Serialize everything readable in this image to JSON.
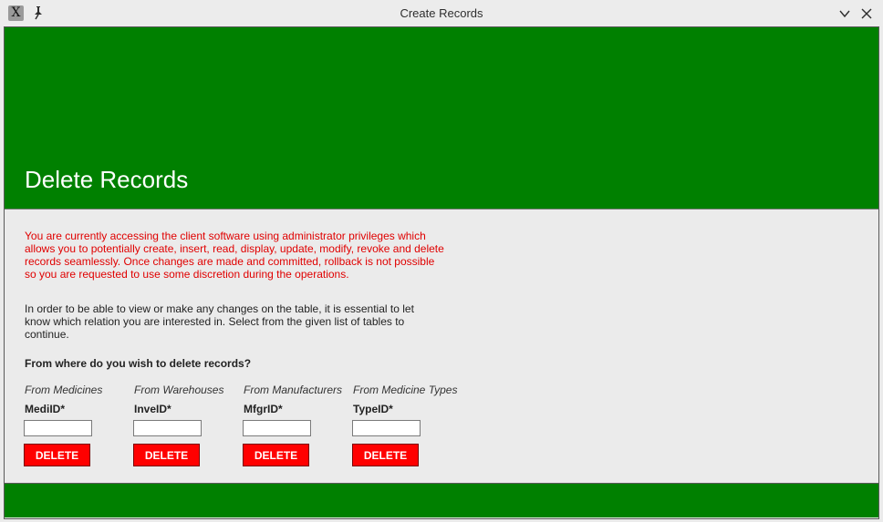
{
  "window": {
    "title": "Create Records",
    "icons": {
      "app": "x-app-icon",
      "pin": "pin-icon",
      "minimize": "chevron-down-icon",
      "close": "close-icon"
    }
  },
  "colors": {
    "header": "#008000",
    "footer": "#008000",
    "warning": "#e00000",
    "delete_button": "#ff0000"
  },
  "header": {
    "title": "Delete Records"
  },
  "body": {
    "warning": "You are currently accessing the client software using administrator privileges which allows you to potentially create, insert, read, display, update, modify, revoke and delete records seamlessly. Once changes are made and committed, rollback is not possible so you are requested to use some discretion during the operations.",
    "info": "In order to be able to view or make any changes on the table, it is essential to let know which relation you are interested in. Select from the given list of tables to continue.",
    "question": "From where do you wish to delete records?"
  },
  "groups": [
    {
      "caption": "From Medicines",
      "label": "MediID*",
      "value": "",
      "button": "DELETE"
    },
    {
      "caption": "From Warehouses",
      "label": "InveID*",
      "value": "",
      "button": "DELETE"
    },
    {
      "caption": "From Manufacturers",
      "label": "MfgrID*",
      "value": "",
      "button": "DELETE"
    },
    {
      "caption": "From Medicine Types",
      "label": "TypeID*",
      "value": "",
      "button": "DELETE"
    }
  ]
}
